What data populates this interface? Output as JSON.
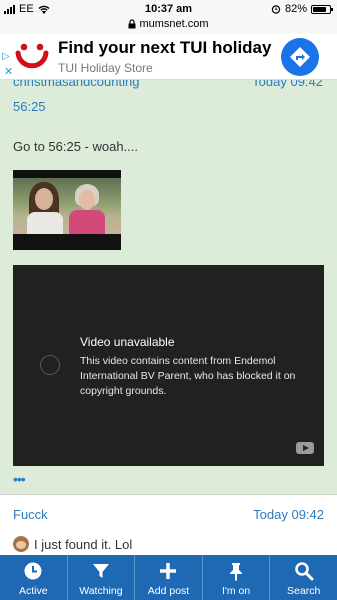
{
  "status_bar": {
    "carrier": "EE",
    "time": "10:37 am",
    "battery": "82%",
    "battery_level": 0.82
  },
  "url_bar": {
    "url": "mumsnet.com"
  },
  "ad": {
    "headline": "Find your next TUI holiday",
    "subtitle": "TUI Holiday Store"
  },
  "post": {
    "author": "christmasandcounting",
    "date": "Today 09:42",
    "timestamp_link": "56:25",
    "message": "Go to 56:25 - woah....",
    "video": {
      "title": "Video unavailable",
      "description": "This video contains content from Endemol International BV Parent, who has blocked it on copyright grounds."
    },
    "more": "•••"
  },
  "next_post": {
    "author": "Fucck",
    "date": "Today 09:42",
    "message": "I just found it. Lol"
  },
  "bottom_nav": {
    "items": [
      {
        "label": "Active",
        "icon": "clock-icon"
      },
      {
        "label": "Watching",
        "icon": "funnel-icon"
      },
      {
        "label": "Add post",
        "icon": "plus-icon"
      },
      {
        "label": "I'm on",
        "icon": "pin-icon"
      },
      {
        "label": "Search",
        "icon": "search-icon"
      }
    ]
  },
  "colors": {
    "link": "#2a7bbf",
    "post_background": "#dcecd9",
    "nav_background": "#1f69b4",
    "ad_button": "#1a73e8"
  }
}
